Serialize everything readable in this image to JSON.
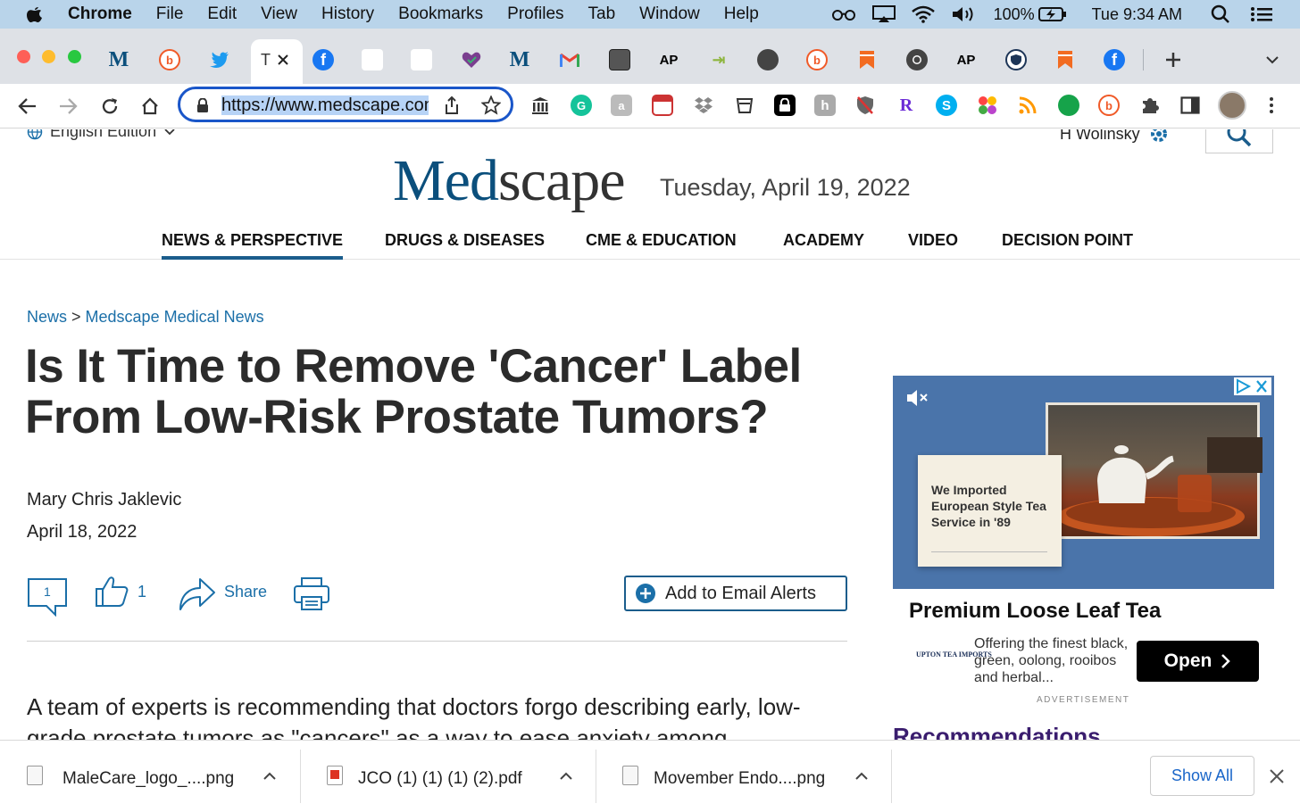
{
  "menubar": {
    "app": "Chrome",
    "items": [
      "File",
      "Edit",
      "View",
      "History",
      "Bookmarks",
      "Profiles",
      "Tab",
      "Window",
      "Help"
    ],
    "battery": "100%",
    "clock": "Tue 9:34 AM"
  },
  "tabs": {
    "active_title": "T",
    "favicons": [
      "M",
      "b",
      "twitter",
      "T",
      "f",
      "",
      "",
      "heart",
      "M",
      "gmail",
      "photo",
      "AP",
      "arrow",
      "globe",
      "b",
      "bookmark",
      "chrome",
      "AP",
      "shield",
      "bookmark",
      "f"
    ]
  },
  "toolbar": {
    "url": "https://www.medscape.com/"
  },
  "page": {
    "edition": "English Edition",
    "user": "H Wolinsky",
    "logo_a": "Med",
    "logo_b": "scape",
    "date": "Tuesday, April 19, 2022",
    "nav": [
      "NEWS & PERSPECTIVE",
      "DRUGS & DISEASES",
      "CME & EDUCATION",
      "ACADEMY",
      "VIDEO",
      "DECISION POINT"
    ],
    "breadcrumb": {
      "home": "News",
      "sep": " > ",
      "section": "Medscape Medical News"
    },
    "headline": "Is It Time to Remove 'Cancer' Label From Low-Risk Prostate Tumors?",
    "author": "Mary Chris Jaklevic",
    "pubdate": "April 18, 2022",
    "comments": "1",
    "likes": "1",
    "share": "Share",
    "email_alerts": "Add to Email Alerts",
    "lead": "A team of experts is recommending that doctors forgo describing early, low-grade prostate tumors as \"cancers\" as a way to ease anxiety among"
  },
  "ad": {
    "card_text": "We Imported European Style Tea Service in '89",
    "title": "Premium Loose Leaf Tea",
    "body": "Offering the finest black, green, oolong, rooibos and herbal...",
    "brand": "UPTON TEA IMPORTS",
    "cta": "Open",
    "label": "ADVERTISEMENT"
  },
  "sidebar": {
    "heading": "Recommendations"
  },
  "downloads": {
    "files": [
      "MaleCare_logo_....png",
      "JCO (1) (1) (1) (2).pdf",
      "Movember Endo....png"
    ],
    "show_all": "Show All"
  }
}
